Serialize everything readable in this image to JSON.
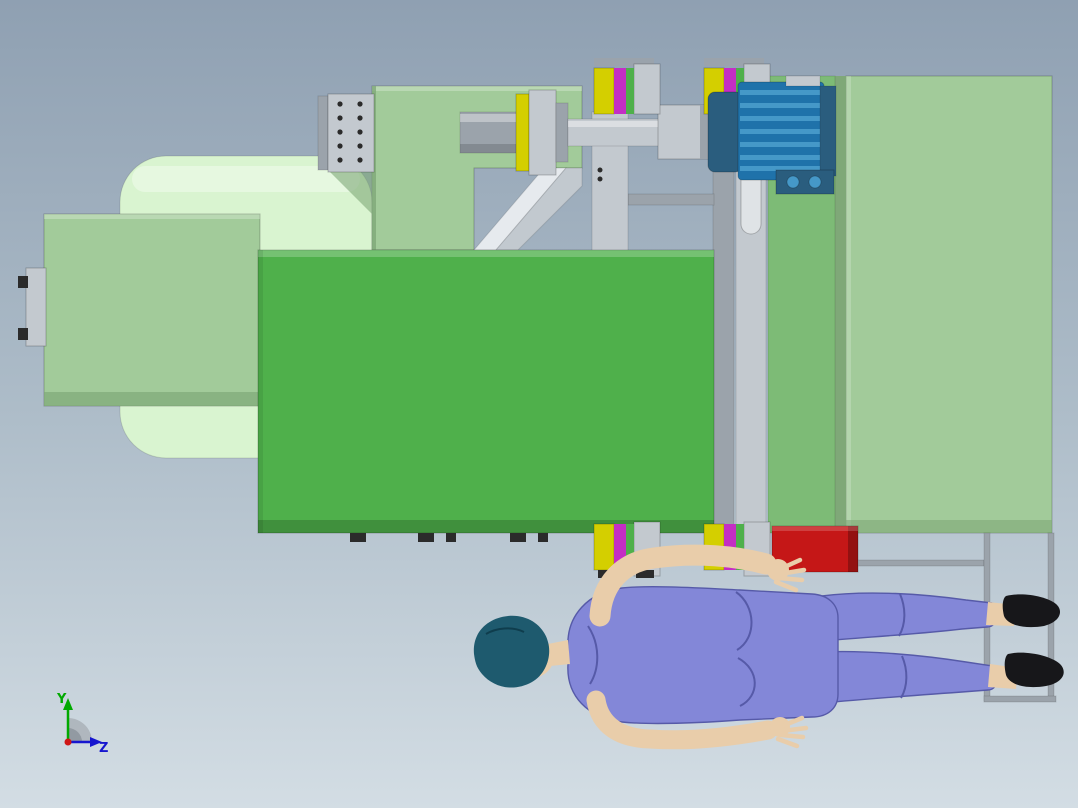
{
  "triad": {
    "y_label": "Y",
    "z_label": "Z"
  },
  "colors": {
    "bg_top": "#8fa0b2",
    "bg_mid": "#aebdc9",
    "bg_bottom": "#d3dde4",
    "machine_green": "#4fb04b",
    "machine_mid_green": "#7dbb76",
    "machine_sage": "#a2cb9a",
    "machine_sage_dark": "#7fa878",
    "machine_pale": "#d9f4d0",
    "steel_xlight": "#dfe3e6",
    "steel_light": "#c3c9cf",
    "steel_mid": "#9ba3ab",
    "steel_dark": "#6f7880",
    "accent_yellow": "#d4cf00",
    "accent_magenta": "#c42ec4",
    "motor_blue": "#1f72aa",
    "motor_blue_light": "#4598c8",
    "motor_blue_dark": "#2a5d7e",
    "alert_red": "#c51717",
    "suit_blue": "#8387d8",
    "suit_blue_dark": "#565aa8",
    "skin": "#e9cdaa",
    "hair_teal": "#1e5a6e",
    "shoe_black": "#17171a",
    "axis_y_green": "#00a900",
    "axis_z_blue": "#1616cf",
    "axis_x_red": "#cf1616"
  }
}
